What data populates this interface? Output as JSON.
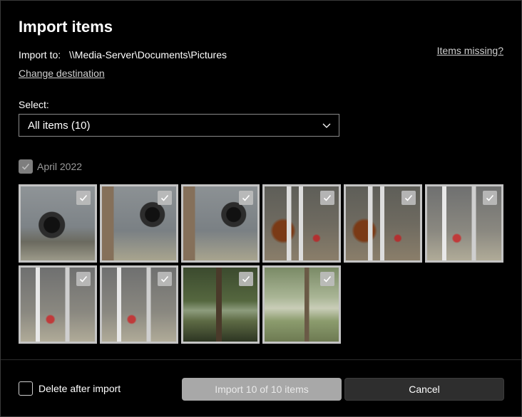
{
  "dialog": {
    "title": "Import items",
    "import_to_label": "Import to:",
    "import_to_path": "\\\\Media-Server\\Documents\\Pictures",
    "change_destination": "Change destination",
    "items_missing": "Items missing?"
  },
  "select": {
    "label": "Select:",
    "value": "All items (10)"
  },
  "group": {
    "label": "April 2022",
    "checked": true
  },
  "thumbnails": [
    {
      "icon": "photo-electric-meter",
      "checked": true
    },
    {
      "icon": "photo-electric-meter",
      "checked": true
    },
    {
      "icon": "photo-electric-meter",
      "checked": true
    },
    {
      "icon": "photo-electrical-panel",
      "checked": true
    },
    {
      "icon": "photo-electrical-panel",
      "checked": true
    },
    {
      "icon": "photo-electrical-panel",
      "checked": true
    },
    {
      "icon": "photo-electrical-panel",
      "checked": true
    },
    {
      "icon": "photo-electrical-panel",
      "checked": true
    },
    {
      "icon": "photo-trees",
      "checked": true
    },
    {
      "icon": "photo-trees",
      "checked": true
    }
  ],
  "footer": {
    "delete_after_import": "Delete after import",
    "delete_checked": false,
    "import_button": "Import 10 of 10 items",
    "cancel_button": "Cancel"
  },
  "colors": {
    "background": "#000000",
    "import_button_bg": "#a8a8a8",
    "cancel_button_bg": "#2e2e2e",
    "thumb_border": "#c4c4c4"
  }
}
